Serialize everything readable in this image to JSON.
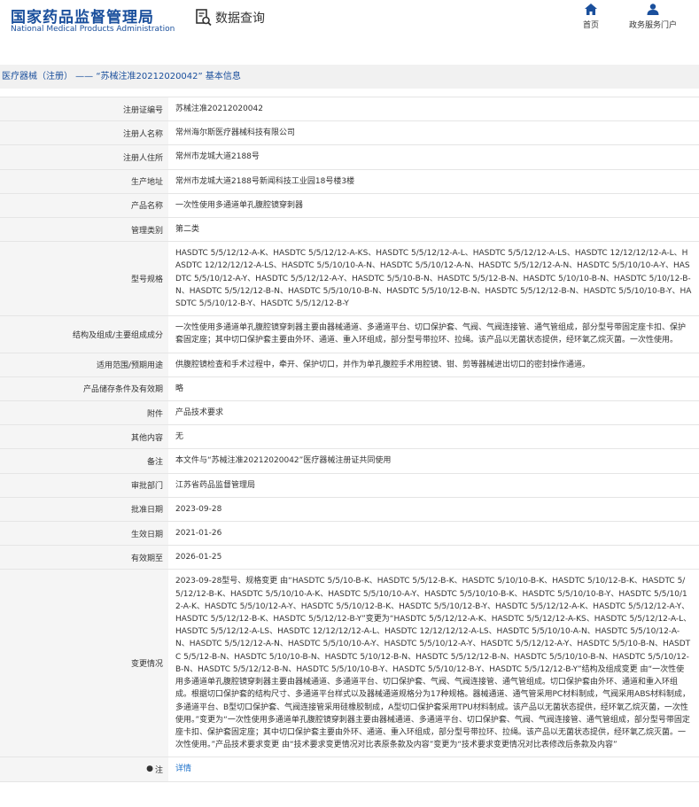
{
  "header": {
    "logo_cn": "国家药品监督管理局",
    "logo_en": "National Medical Products Administration",
    "query_label": "数据查询",
    "nav_home": "首页",
    "nav_gov": "政务服务门户"
  },
  "breadcrumb": "医疗器械（注册） —— “苏械注准20212020042” 基本信息",
  "rows": [
    {
      "label": "注册证编号",
      "value": "苏械注准20212020042"
    },
    {
      "label": "注册人名称",
      "value": "常州海尔斯医疗器械科技有限公司"
    },
    {
      "label": "注册人住所",
      "value": "常州市龙城大道2188号"
    },
    {
      "label": "生产地址",
      "value": "常州市龙城大道2188号新闻科技工业园18号楼3楼"
    },
    {
      "label": "产品名称",
      "value": "一次性使用多通道单孔腹腔镜穿刺器"
    },
    {
      "label": "管理类别",
      "value": "第二类"
    },
    {
      "label": "型号规格",
      "value": "HASDTC 5/5/12/12-A-K、HASDTC 5/5/12/12-A-KS、HASDTC 5/5/12/12-A-L、HASDTC 5/5/12/12-A-LS、HASDTC 12/12/12/12-A-L、HASDTC 12/12/12/12-A-LS、HASDTC 5/5/10/10-A-N、HASDTC 5/5/10/12-A-N、HASDTC 5/5/12/12-A-N、HASDTC 5/5/10/10-A-Y、HASDTC 5/5/10/12-A-Y、HASDTC 5/5/12/12-A-Y、HASDTC 5/5/10-B-N、HASDTC 5/5/12-B-N、HASDTC 5/10/10-B-N、HASDTC 5/10/12-B-N、HASDTC 5/5/12/12-B-N、HASDTC 5/5/10/10-B-N、HASDTC 5/5/10/12-B-N、HASDTC 5/5/12/12-B-N、HASDTC 5/5/10/10-B-Y、HASDTC 5/5/10/12-B-Y、HASDTC 5/5/12/12-B-Y"
    },
    {
      "label": "结构及组成/主要组成成分",
      "value": "一次性使用多通道单孔腹腔镜穿刺器主要由器械通道、多通道平台、切口保护套、气阀、气阀连接管、通气管组成，部分型号带固定座卡扣、保护套固定座；其中切口保护套主要由外环、通道、重入环组成，部分型号带拉环、拉绳。该产品以无菌状态提供，经环氧乙烷灭菌。一次性使用。"
    },
    {
      "label": "适用范围/预期用途",
      "value": "供腹腔镜检查和手术过程中，牵开、保护切口，并作为单孔腹腔手术用腔镜、钳、剪等器械进出切口的密封操作通道。"
    },
    {
      "label": "产品储存条件及有效期",
      "value": "略"
    },
    {
      "label": "附件",
      "value": "产品技术要求"
    },
    {
      "label": "其他内容",
      "value": "无"
    },
    {
      "label": "备注",
      "value": "本文件与“苏械注准20212020042”医疗器械注册证共同使用"
    },
    {
      "label": "审批部门",
      "value": "江苏省药品监督管理局"
    },
    {
      "label": "批准日期",
      "value": "2023-09-28"
    },
    {
      "label": "生效日期",
      "value": "2021-01-26"
    },
    {
      "label": "有效期至",
      "value": "2026-01-25"
    },
    {
      "label": "变更情况",
      "value": "2023-09-28型号、规格变更 由“HASDTC 5/5/10-B-K、HASDTC 5/5/12-B-K、HASDTC 5/10/10-B-K、HASDTC 5/10/12-B-K、HASDTC 5/5/12/12-B-K、HASDTC 5/5/10/10-A-K、HASDTC 5/5/10/10-A-Y、HASDTC 5/5/10/10-B-K、HASDTC 5/5/10/10-B-Y、HASDTC 5/5/10/12-A-K、HASDTC 5/5/10/12-A-Y、HASDTC 5/5/10/12-B-K、HASDTC 5/5/10/12-B-Y、HASDTC 5/5/12/12-A-K、HASDTC 5/5/12/12-A-Y、HASDTC 5/5/12/12-B-K、HASDTC 5/5/12/12-B-Y”变更为“HASDTC 5/5/12/12-A-K、HASDTC 5/5/12/12-A-KS、HASDTC 5/5/12/12-A-L、HASDTC 5/5/12/12-A-LS、HASDTC 12/12/12/12-A-L、HASDTC 12/12/12/12-A-LS、HASDTC 5/5/10/10-A-N、HASDTC 5/5/10/12-A-N、HASDTC 5/5/12/12-A-N、HASDTC 5/5/10/10-A-Y、HASDTC 5/5/10/12-A-Y、HASDTC 5/5/12/12-A-Y、HASDTC 5/5/10-B-N、HASDTC 5/5/12-B-N、HASDTC 5/10/10-B-N、HASDTC 5/10/12-B-N、HASDTC 5/5/12/12-B-N、HASDTC 5/5/10/10-B-N、HASDTC 5/5/10/12-B-N、HASDTC 5/5/12/12-B-N、HASDTC 5/5/10/10-B-Y、HASDTC 5/5/10/12-B-Y、HASDTC 5/5/12/12-B-Y”结构及组成变更 由“一次性使用多通道单孔腹腔镜穿刺器主要由器械通道、多通道平台、切口保护套、气阀、气阀连接管、通气管组成。切口保护套由外环、通道和重入环组成。根据切口保护套的结构尺寸、多通道平台样式以及器械通道规格分为17种规格。器械通道、通气管采用PC材料制成，气阀采用ABS材料制成，多通道平台、B型切口保护套、气阀连接管采用硅橡胶制成，A型切口保护套采用TPU材料制成。该产品以无菌状态提供，经环氧乙烷灭菌，一次性使用。”变更为“一次性使用多通道单孔腹腔镜穿刺器主要由器械通道、多通道平台、切口保护套、气阀、气阀连接管、通气管组成，部分型号带固定座卡扣、保护套固定座；其中切口保护套主要由外环、通道、重入环组成，部分型号带拉环、拉绳。该产品以无菌状态提供，经环氧乙烷灭菌。一次性使用。”产品技术要求变更 由“技术要求变更情况对比表原条款及内容”变更为“技术要求变更情况对比表修改后条款及内容”"
    }
  ],
  "note": {
    "label": "注",
    "value": "详情"
  }
}
